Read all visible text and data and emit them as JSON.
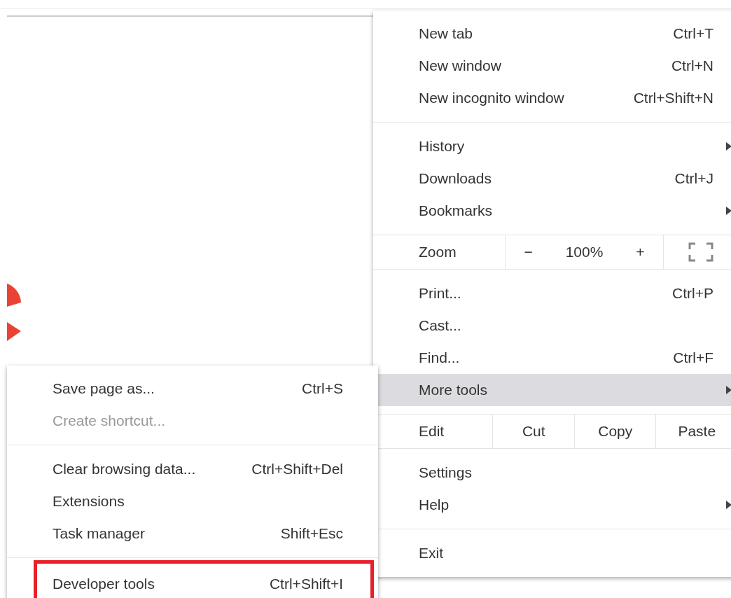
{
  "menu": {
    "sections": [
      {
        "items": [
          {
            "kind": "item",
            "label": "New tab",
            "shortcut": "Ctrl+T",
            "selected": false
          },
          {
            "kind": "item",
            "label": "New window",
            "shortcut": "Ctrl+N",
            "selected": false
          },
          {
            "kind": "item",
            "label": "New incognito window",
            "shortcut": "Ctrl+Shift+N",
            "selected": false
          }
        ]
      },
      {
        "items": [
          {
            "kind": "submenu",
            "label": "History",
            "selected": false
          },
          {
            "kind": "item",
            "label": "Downloads",
            "shortcut": "Ctrl+J",
            "selected": false
          },
          {
            "kind": "submenu",
            "label": "Bookmarks",
            "selected": false
          }
        ]
      },
      {
        "items": [
          {
            "kind": "zoom",
            "label": "Zoom",
            "minus": "−",
            "value": "100%",
            "plus": "+"
          }
        ]
      },
      {
        "items": [
          {
            "kind": "item",
            "label": "Print...",
            "shortcut": "Ctrl+P",
            "selected": false
          },
          {
            "kind": "item",
            "label": "Cast...",
            "selected": false
          },
          {
            "kind": "item",
            "label": "Find...",
            "shortcut": "Ctrl+F",
            "selected": false
          },
          {
            "kind": "submenu",
            "label": "More tools",
            "selected": true
          }
        ]
      },
      {
        "items": [
          {
            "kind": "edit",
            "label": "Edit",
            "buttons": [
              "Cut",
              "Copy",
              "Paste"
            ]
          }
        ]
      },
      {
        "items": [
          {
            "kind": "item",
            "label": "Settings",
            "selected": false
          },
          {
            "kind": "submenu",
            "label": "Help",
            "selected": false
          }
        ]
      },
      {
        "items": [
          {
            "kind": "item",
            "label": "Exit",
            "selected": false
          }
        ]
      }
    ]
  },
  "submenu": {
    "sections": [
      {
        "items": [
          {
            "label": "Save page as...",
            "shortcut": "Ctrl+S",
            "disabled": false,
            "outlined": false
          },
          {
            "label": "Create shortcut...",
            "disabled": true,
            "outlined": false
          }
        ]
      },
      {
        "items": [
          {
            "label": "Clear browsing data...",
            "shortcut": "Ctrl+Shift+Del",
            "disabled": false,
            "outlined": false
          },
          {
            "label": "Extensions",
            "disabled": false,
            "outlined": false
          },
          {
            "label": "Task manager",
            "shortcut": "Shift+Esc",
            "disabled": false,
            "outlined": false
          }
        ]
      },
      {
        "items": [
          {
            "label": "Developer tools",
            "shortcut": "Ctrl+Shift+I",
            "disabled": false,
            "outlined": true
          }
        ]
      }
    ]
  }
}
